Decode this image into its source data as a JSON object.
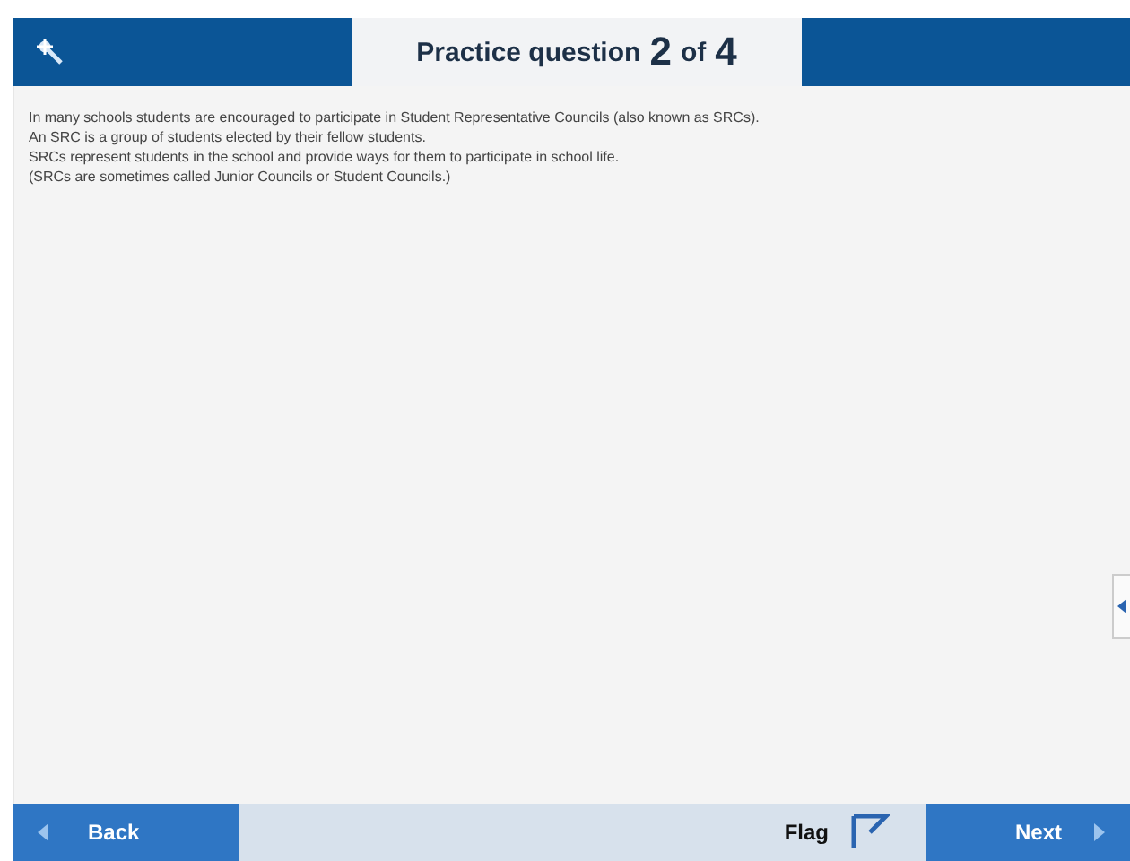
{
  "header": {
    "title_prefix": "Practice question",
    "current": "2",
    "separator": "of",
    "total": "4"
  },
  "passage": [
    "In many schools students are encouraged to participate in Student Representative Councils (also known as SRCs).",
    "An SRC is a group of students elected by their fellow students.",
    "SRCs represent students in the school and provide ways for them to participate in school life.",
    "(SRCs are sometimes called Junior Councils or Student Councils.)"
  ],
  "footer": {
    "back": "Back",
    "flag": {
      "label": "Flag",
      "flagged": false
    },
    "next": "Next"
  }
}
